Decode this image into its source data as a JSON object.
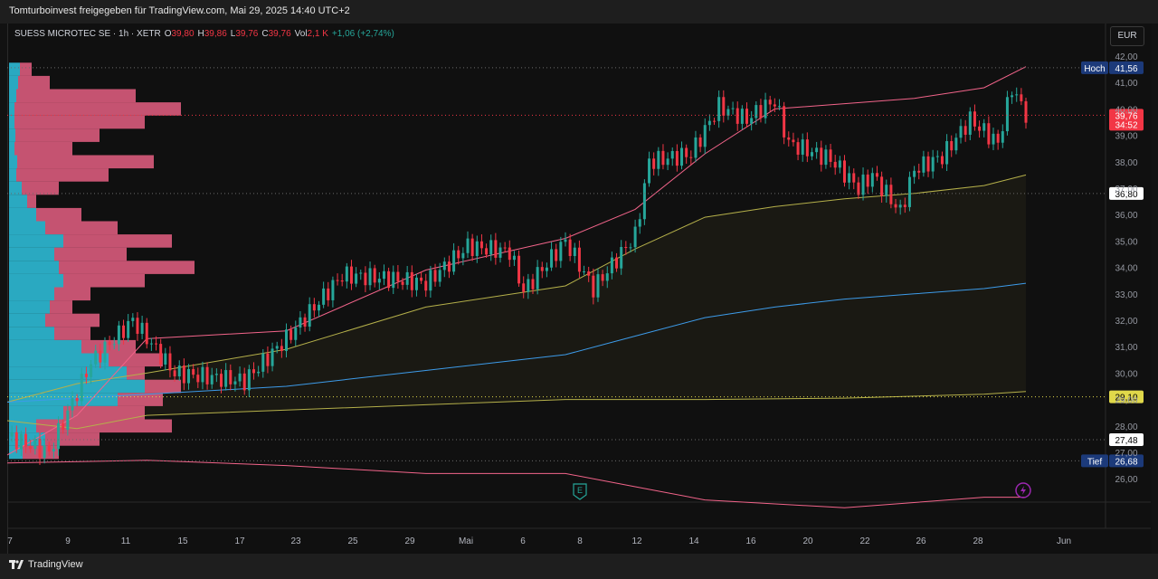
{
  "header": {
    "text": "Tomturboinvest freigegeben für TradingView.com, Mai 29, 2025 14:40 UTC+2"
  },
  "footer": {
    "brand": "TradingView"
  },
  "legend": {
    "symbol": "SUESS MICROTEC SE · 1h · XETR",
    "o_label": "O",
    "o_value": "39,80",
    "h_label": "H",
    "h_value": "39,86",
    "l_label": "L",
    "l_value": "39,76",
    "c_label": "C",
    "c_value": "39,76",
    "vol_label": "Vol",
    "vol_value": "2,1 K",
    "change": "+1,06 (+2,74%)"
  },
  "currency": "EUR",
  "colors": {
    "up": "#26a69a",
    "down": "#f23645",
    "upper_band": "#f2648a",
    "mid_band": "#b5b04a",
    "lower_band": "#3d9be9",
    "profile_up": "#2fc4e0",
    "profile_down": "#f2648a"
  },
  "chart_data": {
    "type": "candlestick",
    "x_ticks": [
      "7",
      "9",
      "11",
      "15",
      "17",
      "23",
      "25",
      "29",
      "Mai",
      "6",
      "8",
      "12",
      "14",
      "16",
      "20",
      "22",
      "26",
      "28",
      "Jun"
    ],
    "y_ticks": [
      "42,00",
      "41,00",
      "40,00",
      "39,00",
      "38,00",
      "37,00",
      "36,00",
      "35,00",
      "34,00",
      "33,00",
      "32,00",
      "31,00",
      "30,00",
      "29,00",
      "28,00",
      "27,00",
      "26,00"
    ],
    "ylim": [
      25.2,
      42.5
    ],
    "labels": [
      {
        "name": "Hoch",
        "value": "41,56"
      },
      {
        "name": "",
        "value": "39,76",
        "sub": "34:52"
      },
      {
        "name": "",
        "value": "36,80"
      },
      {
        "name": "",
        "value": "29,10"
      },
      {
        "name": "",
        "value": "27,48"
      },
      {
        "name": "Tief",
        "value": "26,68"
      }
    ],
    "price_path": [
      [
        0,
        27.6
      ],
      [
        3,
        27.0
      ],
      [
        6,
        30.4
      ],
      [
        9,
        32.0
      ],
      [
        12,
        30.0
      ],
      [
        17,
        29.7
      ],
      [
        20,
        31.3
      ],
      [
        24,
        33.7
      ],
      [
        27,
        33.6
      ],
      [
        30,
        33.4
      ],
      [
        33,
        34.8
      ],
      [
        36,
        34.6
      ],
      [
        37,
        33.1
      ],
      [
        40,
        35.0
      ],
      [
        42,
        33.2
      ],
      [
        45,
        35.2
      ],
      [
        46,
        38.0
      ],
      [
        49,
        38.3
      ],
      [
        51,
        40.1
      ],
      [
        53,
        39.6
      ],
      [
        54,
        40.0
      ],
      [
        55,
        40.3
      ],
      [
        56,
        38.7
      ],
      [
        59,
        38.1
      ],
      [
        61,
        37.0
      ],
      [
        62,
        37.5
      ],
      [
        64,
        36.1
      ],
      [
        65,
        37.7
      ],
      [
        67,
        38.2
      ],
      [
        69,
        39.6
      ],
      [
        71,
        38.7
      ],
      [
        72,
        40.8
      ],
      [
        73,
        39.8
      ]
    ],
    "upper_band": [
      [
        0,
        26.9
      ],
      [
        5,
        28.4
      ],
      [
        10,
        31.3
      ],
      [
        20,
        31.6
      ],
      [
        30,
        33.9
      ],
      [
        40,
        35.1
      ],
      [
        45,
        36.2
      ],
      [
        50,
        38.3
      ],
      [
        55,
        40.0
      ],
      [
        60,
        40.2
      ],
      [
        65,
        40.4
      ],
      [
        70,
        40.8
      ],
      [
        73,
        41.6
      ]
    ],
    "mid_band": [
      [
        0,
        28.9
      ],
      [
        5,
        29.6
      ],
      [
        10,
        30.0
      ],
      [
        20,
        30.9
      ],
      [
        30,
        32.5
      ],
      [
        40,
        33.3
      ],
      [
        45,
        34.7
      ],
      [
        50,
        35.9
      ],
      [
        55,
        36.3
      ],
      [
        60,
        36.6
      ],
      [
        65,
        36.8
      ],
      [
        70,
        37.1
      ],
      [
        73,
        37.5
      ]
    ],
    "lower_band": [
      [
        0,
        28.9
      ],
      [
        10,
        29.2
      ],
      [
        20,
        29.5
      ],
      [
        30,
        30.1
      ],
      [
        40,
        30.7
      ],
      [
        45,
        31.4
      ],
      [
        50,
        32.1
      ],
      [
        55,
        32.5
      ],
      [
        60,
        32.8
      ],
      [
        65,
        33.0
      ],
      [
        70,
        33.2
      ],
      [
        73,
        33.4
      ]
    ],
    "outer_band": [
      [
        0,
        28.2
      ],
      [
        5,
        27.9
      ],
      [
        10,
        28.4
      ],
      [
        20,
        28.6
      ],
      [
        30,
        28.8
      ],
      [
        40,
        29.0
      ],
      [
        50,
        29.0
      ],
      [
        60,
        29.05
      ],
      [
        70,
        29.2
      ],
      [
        73,
        29.3
      ]
    ],
    "lower_outer": [
      [
        0,
        26.6
      ],
      [
        10,
        26.7
      ],
      [
        20,
        26.5
      ],
      [
        30,
        26.2
      ],
      [
        40,
        26.2
      ],
      [
        45,
        25.7
      ],
      [
        50,
        25.2
      ],
      [
        60,
        24.9
      ],
      [
        70,
        25.3
      ],
      [
        73,
        25.3
      ]
    ],
    "volume_profile": [
      {
        "price": 41.5,
        "up": 12,
        "down": 25
      },
      {
        "price": 41.0,
        "up": 10,
        "down": 45
      },
      {
        "price": 40.5,
        "up": 8,
        "down": 140
      },
      {
        "price": 40.0,
        "up": 6,
        "down": 190
      },
      {
        "price": 39.5,
        "up": 6,
        "down": 150
      },
      {
        "price": 39.0,
        "up": 7,
        "down": 100
      },
      {
        "price": 38.5,
        "up": 6,
        "down": 70
      },
      {
        "price": 38.0,
        "up": 9,
        "down": 160
      },
      {
        "price": 37.5,
        "up": 8,
        "down": 110
      },
      {
        "price": 37.0,
        "up": 14,
        "down": 55
      },
      {
        "price": 36.5,
        "up": 20,
        "down": 30
      },
      {
        "price": 36.0,
        "up": 30,
        "down": 80
      },
      {
        "price": 35.5,
        "up": 40,
        "down": 120
      },
      {
        "price": 35.0,
        "up": 60,
        "down": 180
      },
      {
        "price": 34.5,
        "up": 50,
        "down": 130
      },
      {
        "price": 34.0,
        "up": 55,
        "down": 205
      },
      {
        "price": 33.5,
        "up": 60,
        "down": 150
      },
      {
        "price": 33.0,
        "up": 50,
        "down": 90
      },
      {
        "price": 32.5,
        "up": 45,
        "down": 70
      },
      {
        "price": 32.0,
        "up": 40,
        "down": 100
      },
      {
        "price": 31.5,
        "up": 50,
        "down": 90
      },
      {
        "price": 31.0,
        "up": 80,
        "down": 140
      },
      {
        "price": 30.5,
        "up": 110,
        "down": 170
      },
      {
        "price": 30.0,
        "up": 130,
        "down": 150
      },
      {
        "price": 29.5,
        "up": 150,
        "down": 190
      },
      {
        "price": 29.0,
        "up": 120,
        "down": 170
      },
      {
        "price": 28.5,
        "up": 60,
        "down": 150
      },
      {
        "price": 28.0,
        "up": 30,
        "down": 180
      },
      {
        "price": 27.5,
        "up": 40,
        "down": 100
      },
      {
        "price": 27.0,
        "up": 15,
        "down": 55
      }
    ]
  }
}
